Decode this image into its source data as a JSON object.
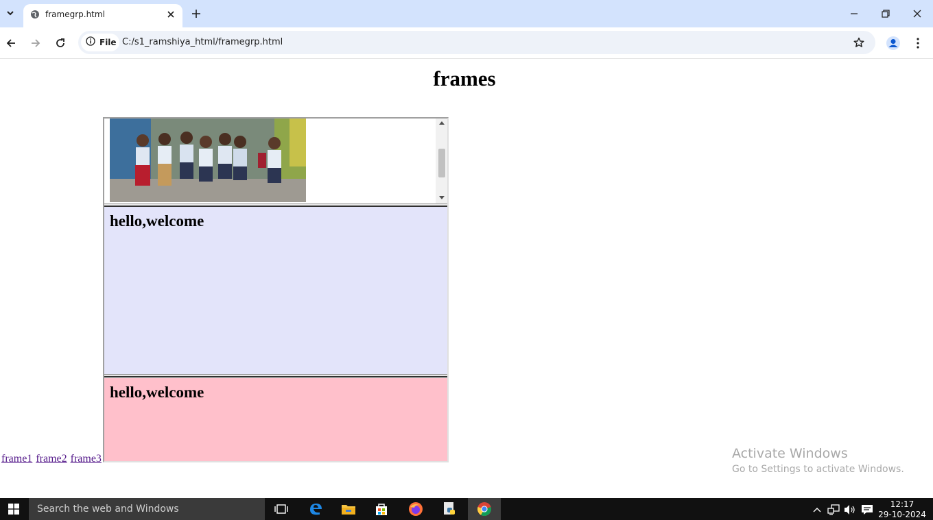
{
  "browser": {
    "tab_title": "framegrp.html",
    "site_info_label": "File",
    "url": "C:/s1_ramshiya_html/framegrp.html"
  },
  "page": {
    "title": "frames",
    "links": [
      "frame1",
      "frame2",
      "frame3"
    ],
    "frame2_heading": "hello,welcome",
    "frame3_heading": "hello,welcome",
    "colors": {
      "frame2_bg": "#e3e4fa",
      "frame3_bg": "#ffc0cb",
      "link": "#551a8b"
    }
  },
  "watermark": {
    "line1": "Activate Windows",
    "line2": "Go to Settings to activate Windows."
  },
  "taskbar": {
    "search_placeholder": "Search the web and Windows",
    "time": "12:17",
    "date": "29-10-2024",
    "pinned": [
      "task-view-icon",
      "edge-icon",
      "file-explorer-icon",
      "store-icon",
      "firefox-icon",
      "python-icon",
      "chrome-icon"
    ]
  }
}
